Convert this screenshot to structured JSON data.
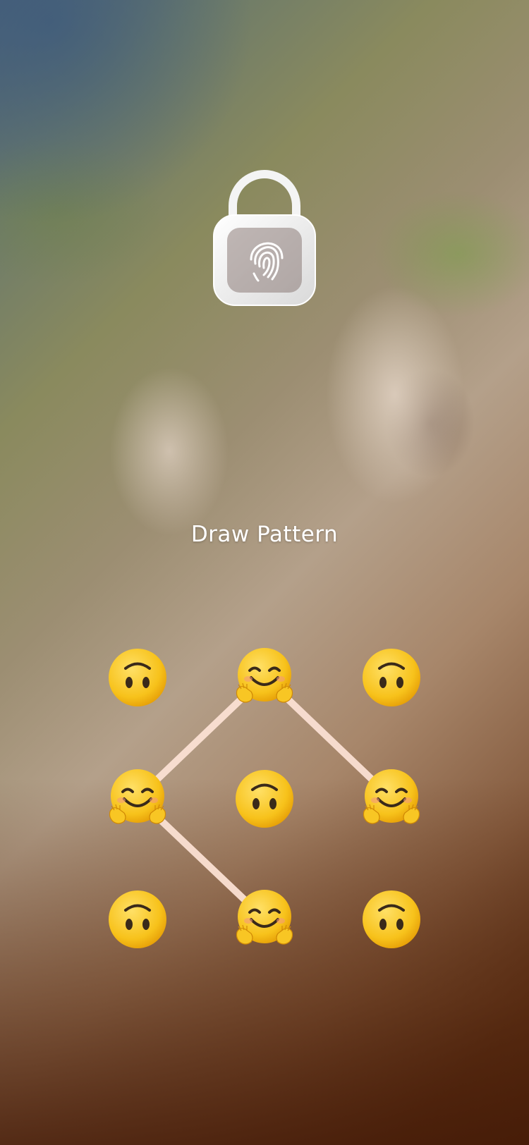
{
  "screen": {
    "title": "Draw Pattern",
    "lock_icon": "fingerprint-padlock-icon"
  },
  "pattern": {
    "grid": [
      {
        "row": 1,
        "col": 1,
        "state": "idle",
        "emoji": "🙃"
      },
      {
        "row": 1,
        "col": 2,
        "state": "selected",
        "emoji": "🤗"
      },
      {
        "row": 1,
        "col": 3,
        "state": "idle",
        "emoji": "🙃"
      },
      {
        "row": 2,
        "col": 1,
        "state": "selected",
        "emoji": "🤗"
      },
      {
        "row": 2,
        "col": 2,
        "state": "idle",
        "emoji": "🙃"
      },
      {
        "row": 2,
        "col": 3,
        "state": "selected",
        "emoji": "🤗"
      },
      {
        "row": 3,
        "col": 1,
        "state": "idle",
        "emoji": "🙃"
      },
      {
        "row": 3,
        "col": 2,
        "state": "selected",
        "emoji": "🤗"
      },
      {
        "row": 3,
        "col": 3,
        "state": "idle",
        "emoji": "🙃"
      }
    ],
    "path_order": [
      [
        2,
        3
      ],
      [
        1,
        2
      ],
      [
        2,
        1
      ],
      [
        3,
        2
      ]
    ],
    "line_color": "#fbe0d3"
  }
}
